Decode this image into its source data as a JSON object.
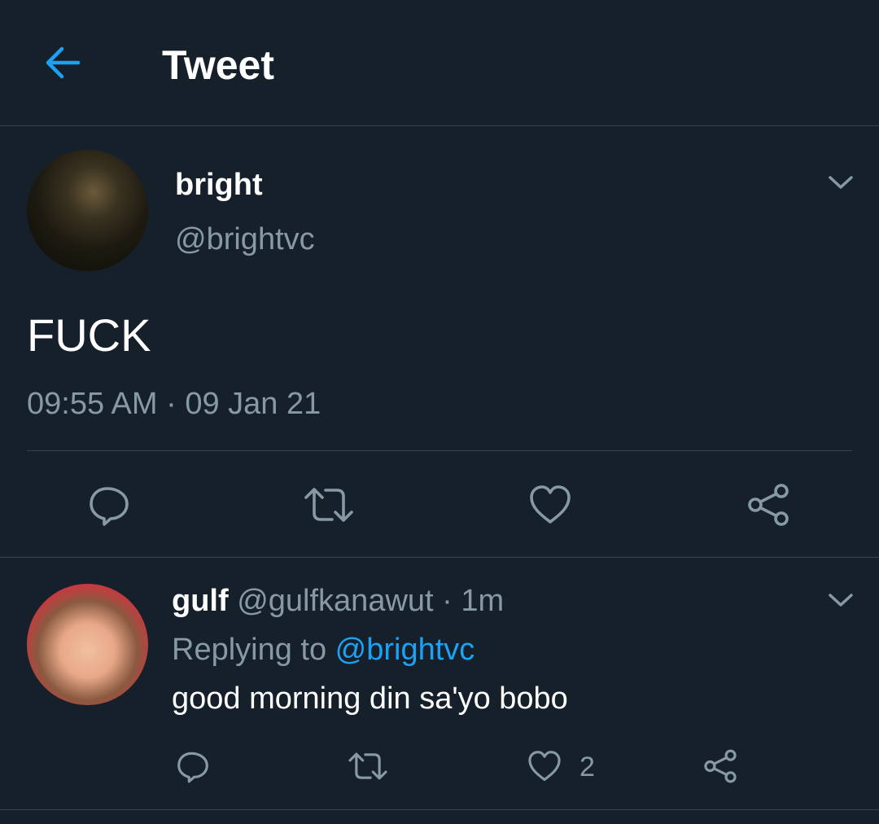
{
  "header": {
    "title": "Tweet",
    "back_icon": "arrow-left-icon"
  },
  "colors": {
    "background": "#15202b",
    "accent": "#1da1f2",
    "secondary_text": "#8899a6",
    "divider": "#38444d"
  },
  "tweet": {
    "author_name": "bright",
    "author_handle": "@brightvc",
    "text": "FUCK",
    "timestamp": "09:55 AM · 09 Jan 21",
    "actions": [
      "reply-icon",
      "retweet-icon",
      "like-icon",
      "share-icon"
    ]
  },
  "reply": {
    "author_name": "gulf",
    "meta": "@gulfkanawut · 1m",
    "replying_prefix": "Replying to ",
    "replying_to": "@brightvc",
    "text": "good morning din sa'yo bobo",
    "like_count": "2",
    "actions": [
      "reply-icon",
      "retweet-icon",
      "like-icon",
      "share-icon"
    ]
  }
}
